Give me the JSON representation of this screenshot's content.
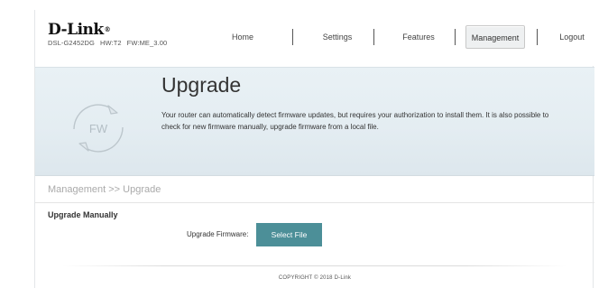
{
  "brand": {
    "logo_text": "D-Link",
    "logo_mark": "®",
    "model": "DSL-G2452DG",
    "hardware": "HW:T2",
    "firmware": "FW:ME_3.00"
  },
  "nav": {
    "items": [
      {
        "label": "Home"
      },
      {
        "label": "Settings"
      },
      {
        "label": "Features"
      },
      {
        "label": "Management",
        "active": true
      },
      {
        "label": "Logout"
      }
    ]
  },
  "banner": {
    "title": "Upgrade",
    "icon_text": "FW",
    "description": "Your router can automatically detect firmware updates, but requires your authorization to install them. It is also possible to check for new firmware manually, upgrade firmware from a local file."
  },
  "breadcrumb": "Management >> Upgrade",
  "upgrade_manually": {
    "section_title": "Upgrade Manually",
    "field_label": "Upgrade Firmware:",
    "button_label": "Select File"
  },
  "footer": {
    "copyright": "COPYRIGHT © 2018 D-Link"
  },
  "colors": {
    "accent_button": "#4c8f98",
    "banner_bg": "#e6eef3"
  },
  "icons": {
    "firmware": "refresh-circle-icon"
  }
}
